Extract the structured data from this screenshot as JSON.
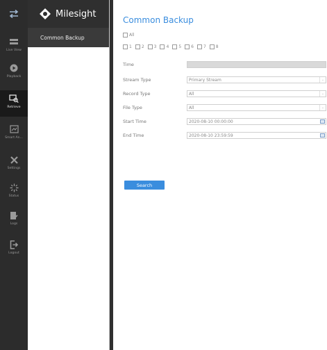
{
  "brand": {
    "name": "Milesight"
  },
  "rail": [
    {
      "label": "Live View",
      "icon": "live-view-icon",
      "active": false
    },
    {
      "label": "Playback",
      "icon": "playback-icon",
      "active": false
    },
    {
      "label": "Retrieve",
      "icon": "retrieve-icon",
      "active": true
    },
    {
      "label": "Smart An...",
      "icon": "smart-analysis-icon",
      "active": false
    },
    {
      "label": "Settings",
      "icon": "settings-icon",
      "active": false
    },
    {
      "label": "Status",
      "icon": "status-icon",
      "active": false
    },
    {
      "label": "Logs",
      "icon": "logs-icon",
      "active": false
    },
    {
      "label": "Logout",
      "icon": "logout-icon",
      "active": false
    }
  ],
  "nav": {
    "active_item": "Common Backup"
  },
  "page": {
    "title": "Common Backup",
    "all_label": "All",
    "channels": [
      "1",
      "2",
      "3",
      "4",
      "5",
      "6",
      "7",
      "8"
    ]
  },
  "form": {
    "time_label": "Time",
    "stream_type_label": "Stream Type",
    "stream_type_value": "Primary Stream",
    "record_type_label": "Record Type",
    "record_type_value": "All",
    "file_type_label": "File Type",
    "file_type_value": "All",
    "start_time_label": "Start Time",
    "start_time_value": "2020-08-10 00:00:00",
    "end_time_label": "End Time",
    "end_time_value": "2020-08-10 23:59:59"
  },
  "search_label": "Search",
  "colors": {
    "accent": "#3a8dde",
    "sidebar": "#2c2c2c"
  }
}
